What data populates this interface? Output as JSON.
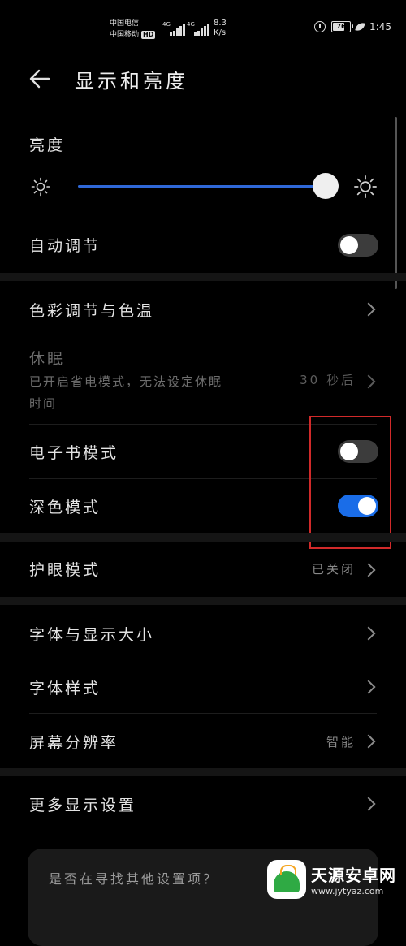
{
  "statusbar": {
    "carrier1": "中国电信",
    "carrier2": "中国移动",
    "hd": "HD",
    "net1": "4G",
    "net2": "4G",
    "speed_value": "8.3",
    "speed_unit": "K/s",
    "battery": "76",
    "battery_level": 0.76,
    "time": "1:45"
  },
  "header": {
    "title": "显示和亮度"
  },
  "brightness": {
    "section_label": "亮度",
    "level_percent": 100
  },
  "settings": {
    "auto_adjust": {
      "label": "自动调节",
      "on": false
    },
    "color_temp": {
      "label": "色彩调节与色温"
    },
    "sleep": {
      "label": "休眠",
      "subtext_line1": "已开启省电模式，无法设定休眠",
      "subtext_line2": "时间",
      "value": "30 秒后"
    },
    "ebook_mode": {
      "label": "电子书模式",
      "on": false
    },
    "dark_mode": {
      "label": "深色模式",
      "on": true
    },
    "eye_care": {
      "label": "护眼模式",
      "value": "已关闭"
    },
    "font_size": {
      "label": "字体与显示大小"
    },
    "font_style": {
      "label": "字体样式"
    },
    "resolution": {
      "label": "屏幕分辨率",
      "value": "智能"
    },
    "more_display": {
      "label": "更多显示设置"
    }
  },
  "suggestion": {
    "title": "是否在寻找其他设置项？"
  },
  "watermark": {
    "title": "天源安卓网",
    "url": "www.jytyaz.com"
  },
  "colors": {
    "accent": "#1a6de8",
    "slider": "#2f68d8",
    "highlight": "#d12a2a",
    "background": "#000000"
  }
}
